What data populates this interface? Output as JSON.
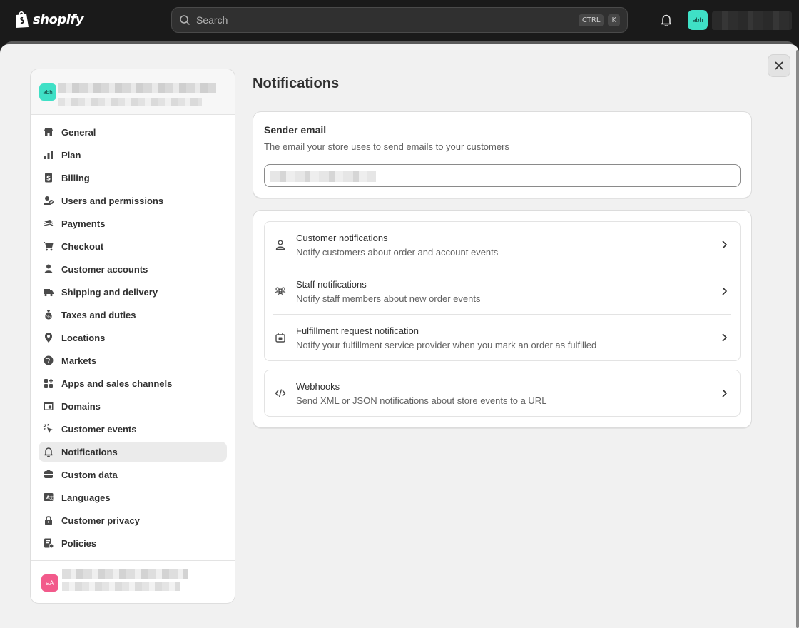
{
  "topbar": {
    "brand": "shopify",
    "search_placeholder": "Search",
    "shortcut_keys": [
      "CTRL",
      "K"
    ],
    "user_avatar": "abh"
  },
  "sidebar": {
    "store_avatar": "abh",
    "footer_avatar": "aA",
    "items": [
      {
        "label": "General",
        "icon": "store-icon"
      },
      {
        "label": "Plan",
        "icon": "plan-icon"
      },
      {
        "label": "Billing",
        "icon": "billing-icon"
      },
      {
        "label": "Users and permissions",
        "icon": "users-icon"
      },
      {
        "label": "Payments",
        "icon": "payments-icon"
      },
      {
        "label": "Checkout",
        "icon": "cart-icon"
      },
      {
        "label": "Customer accounts",
        "icon": "person-icon"
      },
      {
        "label": "Shipping and delivery",
        "icon": "truck-icon"
      },
      {
        "label": "Taxes and duties",
        "icon": "tax-icon"
      },
      {
        "label": "Locations",
        "icon": "location-icon"
      },
      {
        "label": "Markets",
        "icon": "globe-icon"
      },
      {
        "label": "Apps and sales channels",
        "icon": "apps-icon"
      },
      {
        "label": "Domains",
        "icon": "domain-icon"
      },
      {
        "label": "Customer events",
        "icon": "cursor-icon"
      },
      {
        "label": "Notifications",
        "icon": "bell-icon",
        "active": true
      },
      {
        "label": "Custom data",
        "icon": "database-icon"
      },
      {
        "label": "Languages",
        "icon": "language-icon"
      },
      {
        "label": "Customer privacy",
        "icon": "lock-icon"
      },
      {
        "label": "Policies",
        "icon": "policy-icon"
      }
    ]
  },
  "main": {
    "title": "Notifications",
    "sender": {
      "title": "Sender email",
      "description": "The email your store uses to send emails to your customers"
    },
    "rows": [
      {
        "title": "Customer notifications",
        "description": "Notify customers about order and account events",
        "icon": "person-outline-icon"
      },
      {
        "title": "Staff notifications",
        "description": "Notify staff members about new order events",
        "icon": "team-icon"
      },
      {
        "title": "Fulfillment request notification",
        "description": "Notify your fulfillment service provider when you mark an order as fulfilled",
        "icon": "fulfillment-icon"
      },
      {
        "title": "Webhooks",
        "description": "Send XML or JSON notifications about store events to a URL",
        "icon": "code-icon"
      }
    ]
  }
}
